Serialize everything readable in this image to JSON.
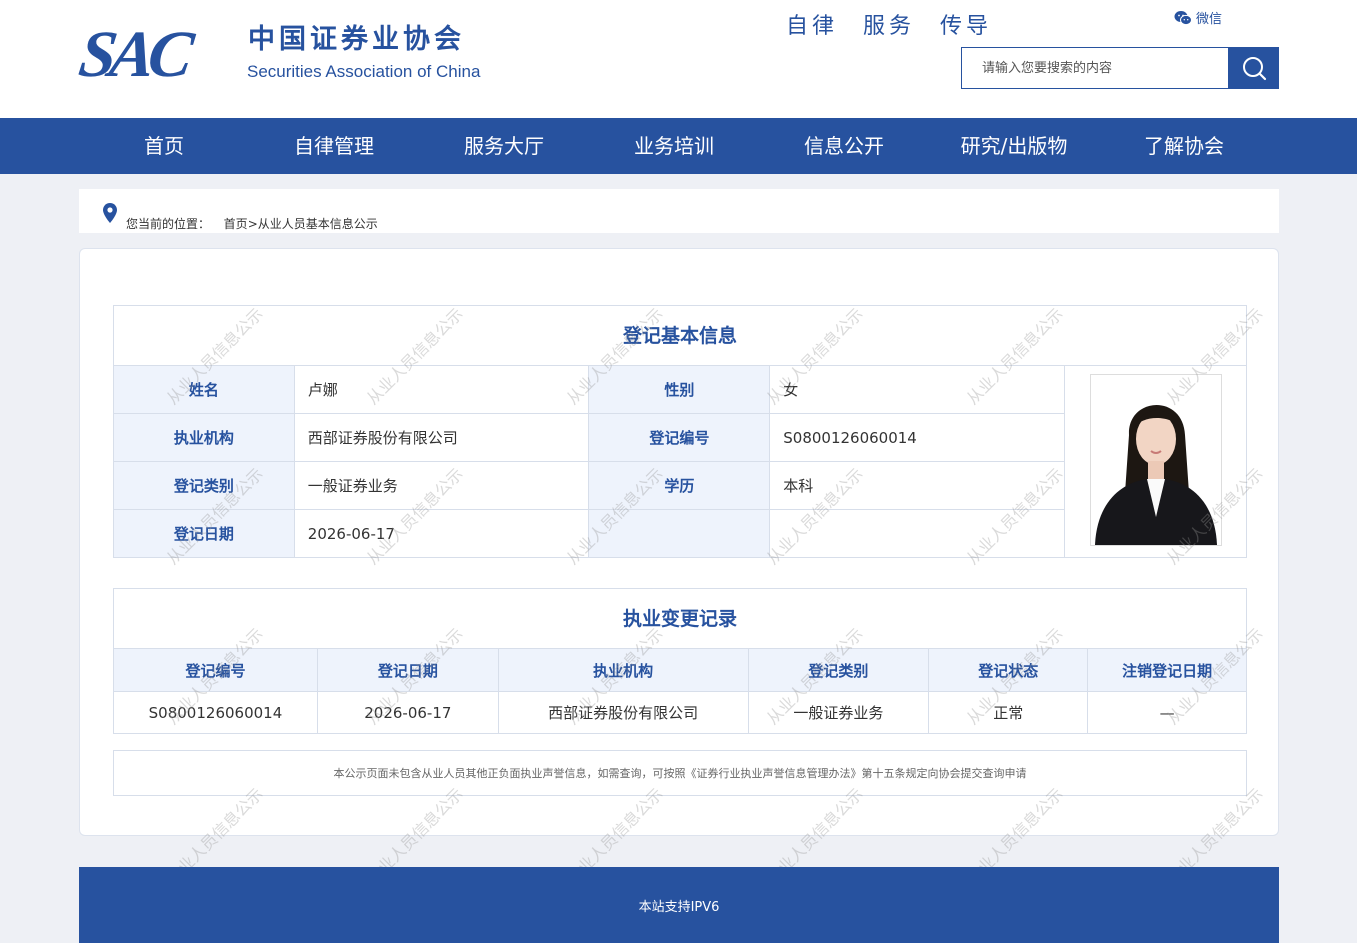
{
  "header": {
    "logo_sac": "SAC",
    "logo_cn": "中国证券业协会",
    "logo_en": "Securities Association of China",
    "slogan": "自律 服务 传导",
    "wechat_label": "微信",
    "search_placeholder": "请输入您要搜索的内容"
  },
  "nav": {
    "items": [
      {
        "label": "首页"
      },
      {
        "label": "自律管理"
      },
      {
        "label": "服务大厅"
      },
      {
        "label": "业务培训"
      },
      {
        "label": "信息公开"
      },
      {
        "label": "研究/出版物"
      },
      {
        "label": "了解协会"
      }
    ]
  },
  "breadcrumb": {
    "prefix": "您当前的位置：",
    "home": "首页",
    "separator": ">",
    "current": "从业人员基本信息公示"
  },
  "basic_info": {
    "title": "登记基本信息",
    "name_label": "姓名",
    "name_value": "卢娜",
    "gender_label": "性别",
    "gender_value": "女",
    "org_label": "执业机构",
    "org_value": "西部证券股份有限公司",
    "reg_no_label": "登记编号",
    "reg_no_value": "S0800126060014",
    "category_label": "登记类别",
    "category_value": "一般证券业务",
    "education_label": "学历",
    "education_value": "本科",
    "date_label": "登记日期",
    "date_value": "2026-06-17"
  },
  "change_record": {
    "title": "执业变更记录",
    "columns": [
      "登记编号",
      "登记日期",
      "执业机构",
      "登记类别",
      "登记状态",
      "注销登记日期"
    ],
    "rows": [
      [
        "S0800126060014",
        "2026-06-17",
        "西部证券股份有限公司",
        "一般证券业务",
        "正常",
        "—"
      ]
    ]
  },
  "notice": "本公示页面未包含从业人员其他正负面执业声誉信息，如需查询，可按照《证券行业执业声誉信息管理办法》第十五条规定向协会提交查询申请",
  "watermark_text": "从业人员信息公示",
  "footer": {
    "text": "本站支持IPV6"
  },
  "colors": {
    "brand": "#27529f",
    "label_bg": "#eef3fc"
  }
}
